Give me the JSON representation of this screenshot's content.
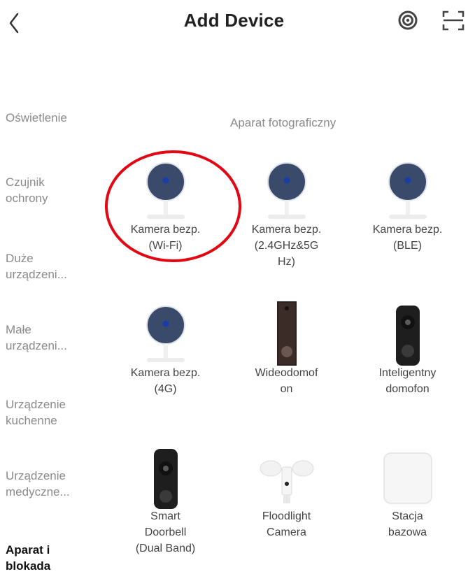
{
  "header": {
    "title": "Add Device",
    "icons": [
      "back-chevron-icon",
      "nearby-scan-icon",
      "qr-scan-icon"
    ]
  },
  "sidebar": {
    "items": [
      {
        "label": "Oświetlenie"
      },
      {
        "label": "Czujnik\nochrony"
      },
      {
        "label": "Duże\nurządzeni..."
      },
      {
        "label": "Małe\nurządzeni..."
      },
      {
        "label": "Urządzenie\nkuchenne"
      },
      {
        "label": "Urządzenie\nmedyczne..."
      },
      {
        "label": "Aparat i\nblokada",
        "active": true
      }
    ]
  },
  "main": {
    "section_title": "Aparat fotograficzny",
    "devices": [
      {
        "label": "Kamera bezp.\n(Wi-Fi)",
        "icon": "security-camera-icon"
      },
      {
        "label": "Kamera bezp.\n(2.4GHz&5G\nHz)",
        "icon": "security-camera-icon"
      },
      {
        "label": "Kamera bezp.\n(BLE)",
        "icon": "security-camera-icon"
      },
      {
        "label": "Kamera bezp.\n(4G)",
        "icon": "security-camera-icon"
      },
      {
        "label": "Wideodomof\non",
        "icon": "video-intercom-icon"
      },
      {
        "label": "Inteligentny\ndomofon",
        "icon": "smart-doorbell-icon"
      },
      {
        "label": "Smart\nDoorbell\n(Dual Band)",
        "icon": "smart-doorbell-icon"
      },
      {
        "label": "Floodlight\nCamera",
        "icon": "floodlight-camera-icon"
      },
      {
        "label": "Stacja\nbazowa",
        "icon": "base-station-icon"
      }
    ]
  },
  "colors": {
    "highlight": "#e30613",
    "camera_lens": "#3a4a6b",
    "doorbell_body": "#1e1e1e"
  }
}
